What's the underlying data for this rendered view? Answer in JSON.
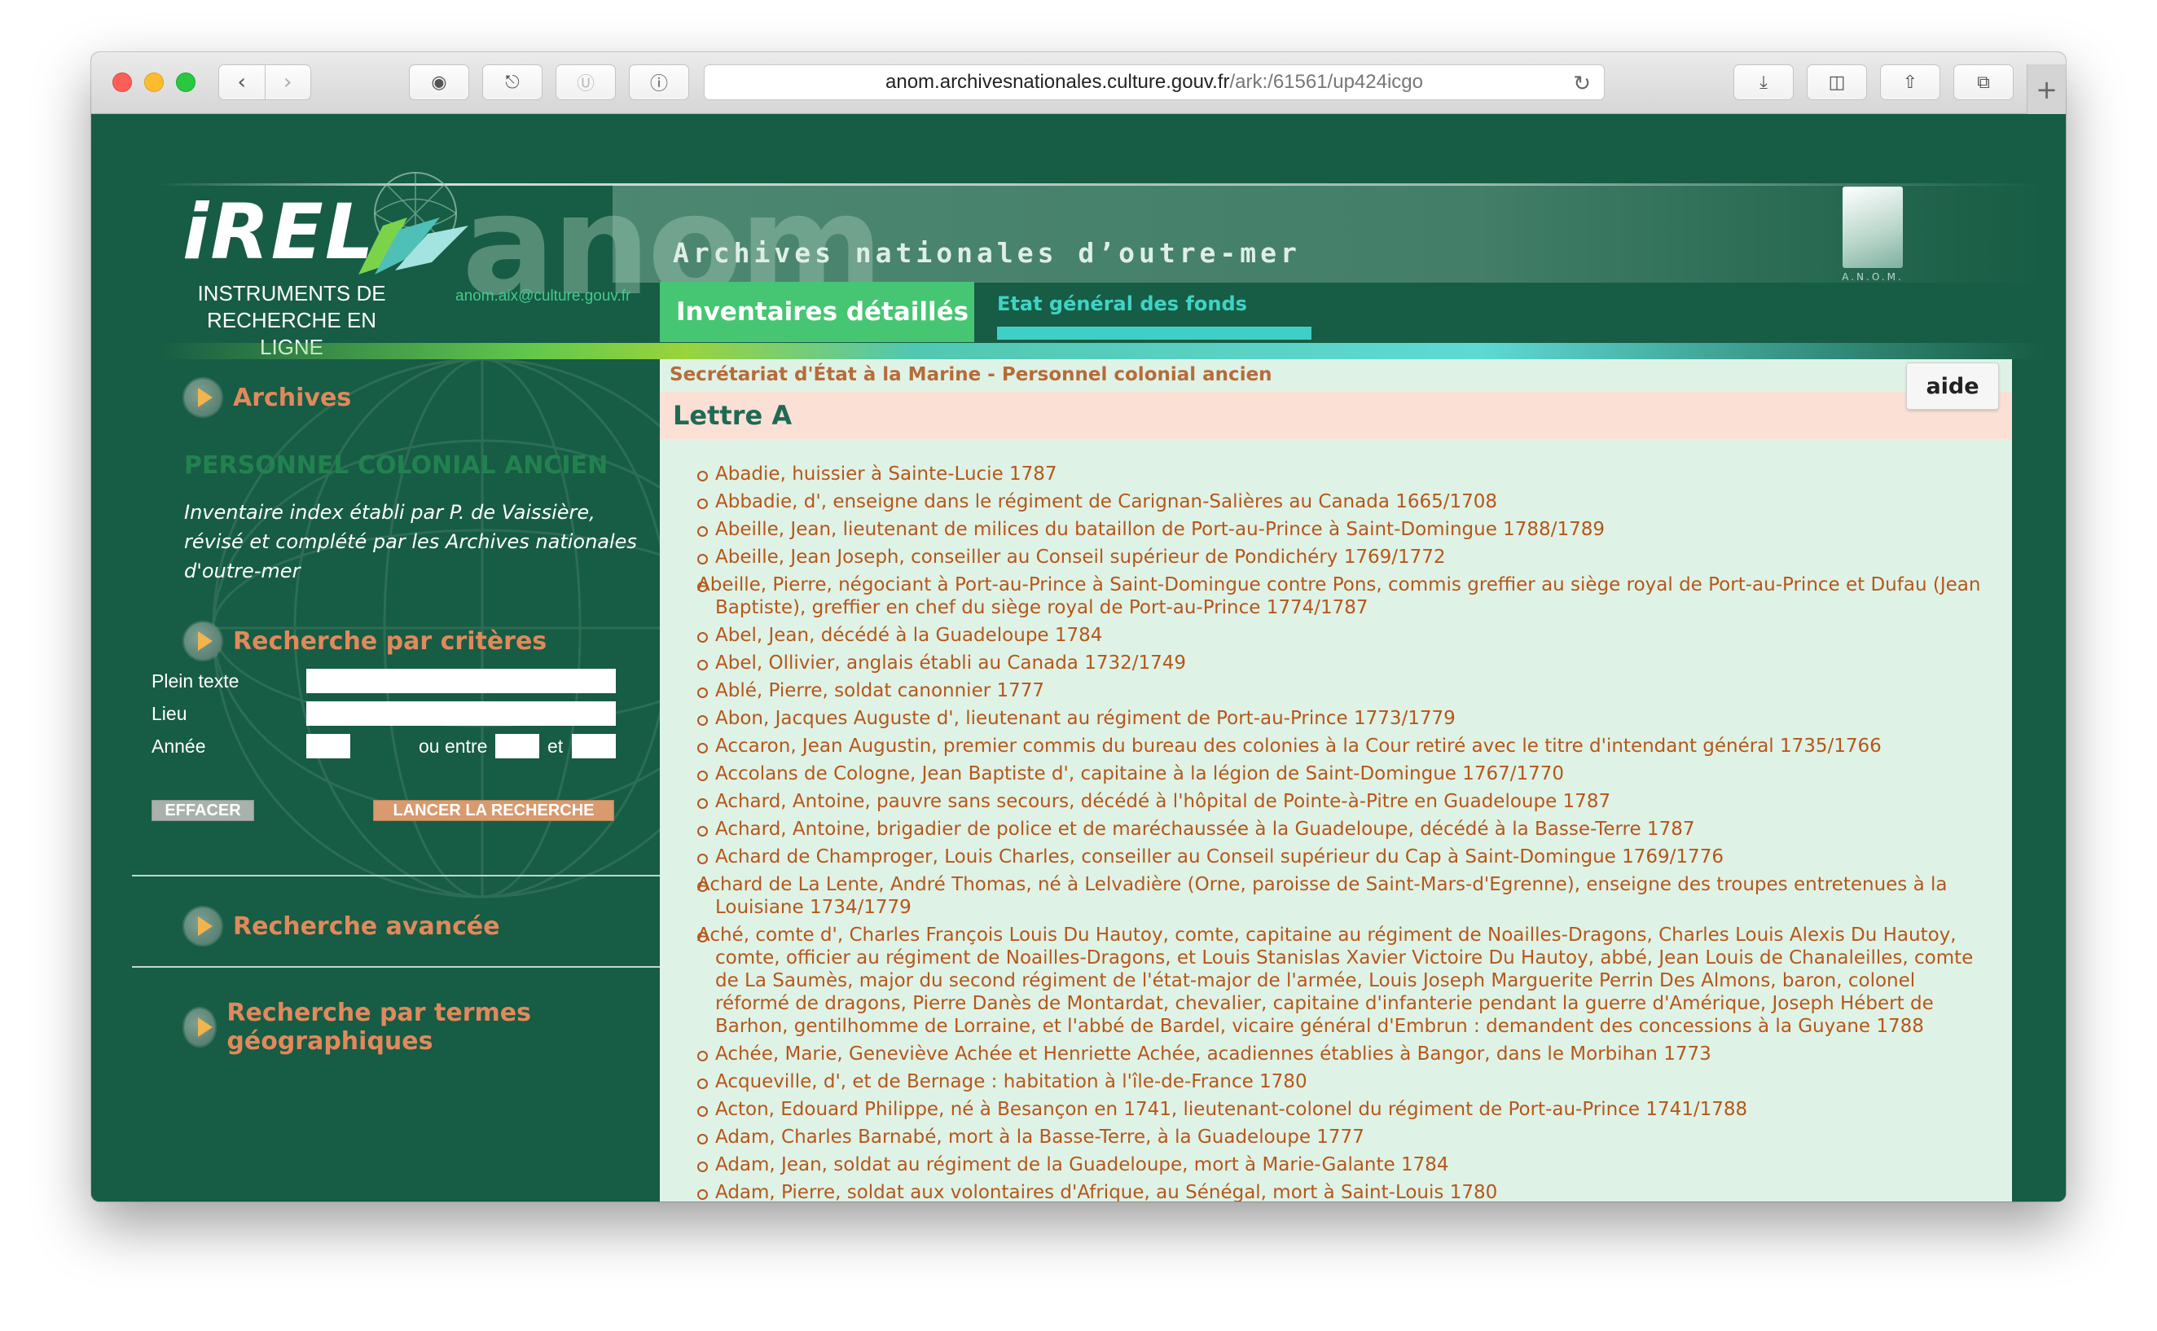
{
  "browser": {
    "url_domain": "anom.archivesnationales.culture.gouv.fr",
    "url_path": "/ark:/61561/up424icgo",
    "icons": [
      "back-icon",
      "forward-icon",
      "ghostery-icon",
      "readability-icon",
      "z-icon",
      "info-icon",
      "reload-icon",
      "download-icon",
      "sidebar-icon",
      "share-icon",
      "tabs-icon",
      "new-tab-icon"
    ]
  },
  "header": {
    "logo_text": "iREL",
    "logo_tagline": "INSTRUMENTS DE RECHERCHE EN LIGNE",
    "anom_big": "anom",
    "anom_subtitle": "Archives nationales d’outre-mer",
    "email": "anom.aix@culture.gouv.fr",
    "anom_logo_label": "A.N.O.M.",
    "tabs": [
      {
        "label": "Inventaires détaillés",
        "active": true
      },
      {
        "label": "Etat général des fonds",
        "active": false
      }
    ],
    "colors": {
      "active_tab": "#46c673",
      "other_tab": "#3fcfc6",
      "background": "#175c44"
    }
  },
  "sidebar": {
    "archives_title": "Archives",
    "fonds_title": "PERSONNEL COLONIAL ANCIEN",
    "description": "Inventaire index établi par P. de Vaissière, révisé et complété par les Archives nationales d'outre-mer",
    "search_title": "Recherche par critères",
    "fields": {
      "plein_texte": "Plein texte",
      "lieu": "Lieu",
      "annee": "Année",
      "ou_entre": "ou entre",
      "et": "et"
    },
    "btn_clear": "EFFACER",
    "btn_search": "LANCER LA RECHERCHE",
    "advanced_title": "Recherche avancée",
    "geo_title": "Recherche par termes géographiques"
  },
  "content": {
    "breadcrumb": "Secrétariat d'État à la Marine - Personnel colonial ancien",
    "aide_label": "aide",
    "letter": "Lettre A",
    "entries": [
      "Abadie, huissier à Sainte-Lucie 1787",
      "Abbadie, d', enseigne dans le régiment de Carignan-Salières au Canada 1665/1708",
      "Abeille, Jean, lieutenant de milices du bataillon de Port-au-Prince à Saint-Domingue 1788/1789",
      "Abeille, Jean Joseph, conseiller au Conseil supérieur de Pondichéry 1769/1772",
      "Abeille, Pierre, négociant à Port-au-Prince à Saint-Domingue contre Pons, commis greffier au siège royal de Port-au-Prince et Dufau (Jean Baptiste), greffier en chef du siège royal de Port-au-Prince 1774/1787",
      "Abel, Jean, décédé à la Guadeloupe 1784",
      "Abel, Ollivier, anglais établi au Canada 1732/1749",
      "Ablé, Pierre, soldat canonnier 1777",
      "Abon, Jacques Auguste d', lieutenant au régiment de Port-au-Prince 1773/1779",
      "Accaron, Jean Augustin, premier commis du bureau des colonies à la Cour retiré avec le titre d'intendant général 1735/1766",
      "Accolans de Cologne, Jean Baptiste d', capitaine à la légion de Saint-Domingue 1767/1770",
      "Achard, Antoine, pauvre sans secours, décédé à l'hôpital de Pointe-à-Pitre en Guadeloupe 1787",
      "Achard, Antoine, brigadier de police et de maréchaussée à la Guadeloupe, décédé à la Basse-Terre 1787",
      "Achard de Champroger, Louis Charles, conseiller au Conseil supérieur du Cap à Saint-Domingue 1769/1776",
      "Achard de La Lente, André Thomas, né à Lelvadière (Orne, paroisse de Saint-Mars-d'Egrenne), enseigne des troupes entretenues à la Louisiane 1734/1779",
      "Aché, comte d', Charles François Louis Du Hautoy, comte, capitaine au régiment de Noailles-Dragons, Charles Louis Alexis Du Hautoy, comte, officier au régiment de Noailles-Dragons, et Louis Stanislas Xavier Victoire Du Hautoy, abbé, Jean Louis de Chanaleilles, comte de La Saumès, major du second régiment de l'état-major de l'armée, Louis Joseph Marguerite Perrin Des Almons, baron, colonel réformé de dragons, Pierre Danès de Montardat, chevalier, capitaine d'infanterie pendant la guerre d'Amérique, Joseph Hébert de Barhon, gentilhomme de Lorraine, et l'abbé de Bardel, vicaire général d'Embrun : demandent des concessions à la Guyane 1788",
      "Achée, Marie, Geneviève Achée et Henriette Achée, acadiennes établies à Bangor, dans le Morbihan 1773",
      "Acqueville, d', et de Bernage : habitation à l'île-de-France 1780",
      "Acton, Edouard Philippe, né à Besançon en 1741, lieutenant-colonel du régiment de Port-au-Prince 1741/1788",
      "Adam, Charles Barnabé, mort à la Basse-Terre, à la Guadeloupe 1777",
      "Adam, Jean, soldat au régiment de la Guadeloupe, mort à Marie-Galante 1784",
      "Adam, Pierre, soldat aux volontaires d'Afrique, au Sénégal, mort à Saint-Louis 1780"
    ]
  }
}
